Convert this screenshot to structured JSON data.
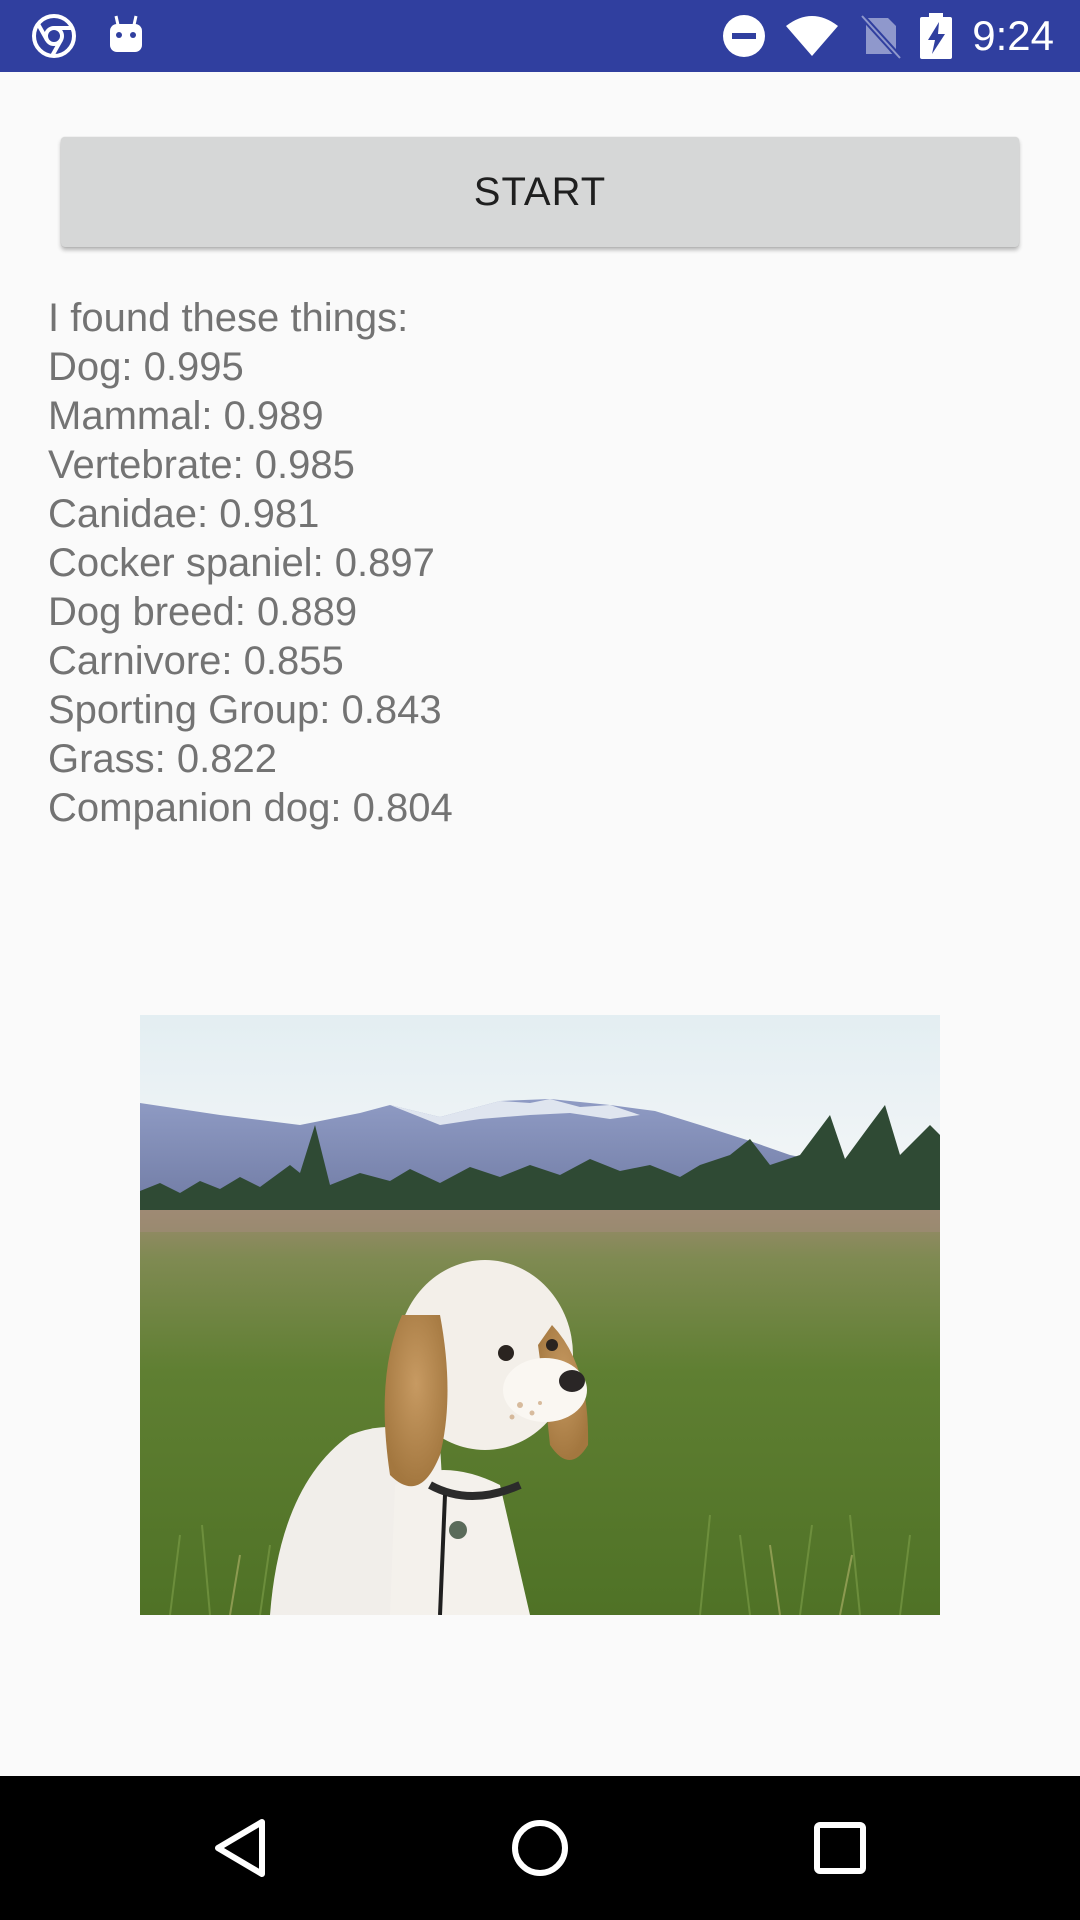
{
  "status_bar": {
    "background": "#303f9f",
    "time": "9:24",
    "left_icons": [
      "chrome-icon",
      "android-debug-icon"
    ],
    "right_icons": [
      "do-not-disturb-icon",
      "wifi-icon",
      "no-sim-icon",
      "battery-charging-icon"
    ]
  },
  "main": {
    "start_button_label": "START",
    "results": {
      "header": "I found these things:",
      "items": [
        "Dog: 0.995",
        "Mammal: 0.989",
        "Vertebrate: 0.985",
        "Canidae: 0.981",
        "Cocker spaniel: 0.897",
        "Dog breed: 0.889",
        "Carnivore: 0.855",
        "Sporting Group: 0.843",
        "Grass: 0.822",
        "Companion dog: 0.804"
      ]
    },
    "photo": {
      "subject": "dog-in-meadow-photo"
    }
  },
  "nav_bar": {
    "buttons": [
      "back-icon",
      "home-icon",
      "recents-icon"
    ]
  }
}
